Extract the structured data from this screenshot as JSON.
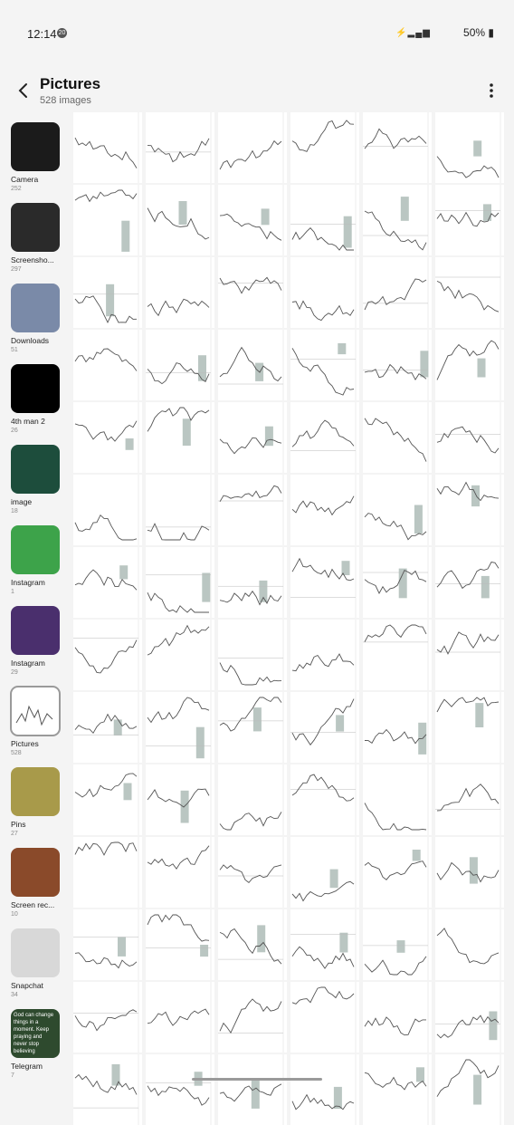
{
  "status_bar": {
    "time": "12:14",
    "notification_count": "20",
    "battery": "50%"
  },
  "header": {
    "title": "Pictures",
    "subtitle": "528 images"
  },
  "albums": [
    {
      "name": "Camera",
      "count": "252",
      "thumb": "#1b1b1b"
    },
    {
      "name": "Screensho...",
      "count": "297",
      "thumb": "#2a2a2a"
    },
    {
      "name": "Downloads",
      "count": "51",
      "thumb": "#7a8aa8"
    },
    {
      "name": "4th man  2",
      "count": "26",
      "thumb": "#000000"
    },
    {
      "name": "image",
      "count": "18",
      "thumb": "#1d4d3c"
    },
    {
      "name": "Instagram",
      "count": "1",
      "thumb": "#3da34a"
    },
    {
      "name": "Instagram",
      "count": "29",
      "thumb": "#4a2f6d"
    },
    {
      "name": "Pictures",
      "count": "528",
      "thumb": "#ffffff"
    },
    {
      "name": "Pins",
      "count": "27",
      "thumb": "#a89a4a"
    },
    {
      "name": "Screen rec...",
      "count": "10",
      "thumb": "#8a4a2a"
    },
    {
      "name": "Snapchat",
      "count": "34",
      "thumb": "#d8d8d8"
    },
    {
      "name": "Telegram",
      "count": "7",
      "thumb": "#2e4a2e"
    }
  ],
  "telegram_thumb_text": "God can change things in a moment. Keep praying and never stop believing",
  "grid": {
    "columns": 6,
    "rows": 14
  }
}
